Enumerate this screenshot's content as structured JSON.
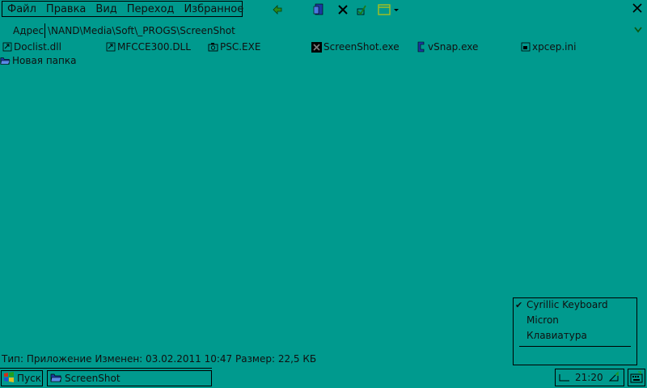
{
  "menubar": {
    "items": [
      "Файл",
      "Правка",
      "Вид",
      "Переход",
      "Избранное"
    ]
  },
  "toolbar": {
    "icons": [
      "back-icon",
      "properties-icon",
      "delete-icon",
      "checkmark-icon",
      "view-mode-icon"
    ]
  },
  "address": {
    "label": "Адрес",
    "value": "\\NAND\\Media\\Soft\\_PROGS\\ScreenShot"
  },
  "files": [
    {
      "name": "Doclist.dll"
    },
    {
      "name": "MFCCE300.DLL"
    },
    {
      "name": "PSC.EXE"
    },
    {
      "name": "ScreenShot.exe"
    },
    {
      "name": "vSnap.exe"
    },
    {
      "name": "xpcep.ini"
    },
    {
      "name": "Новая папка"
    }
  ],
  "status": {
    "text": "Тип: Приложение Изменен: 03.02.2011 10:47 Размер: 22,5 КБ"
  },
  "taskbar": {
    "start_label": "Пуск",
    "task_label": "ScreenShot",
    "time": "21:20"
  },
  "popup": {
    "items": [
      {
        "label": "Cyrillic Keyboard",
        "checked": true
      },
      {
        "label": "Micron",
        "checked": false
      },
      {
        "label": "Клавиатура",
        "checked": false
      }
    ]
  },
  "colors": {
    "background": "#009a8e",
    "text": "#101010"
  }
}
